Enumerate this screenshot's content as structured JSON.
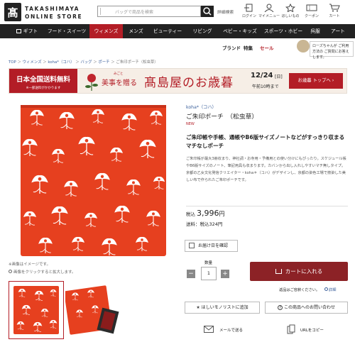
{
  "header": {
    "logo_line1": "TAKASHIMAYA",
    "logo_line2": "ONLINE STORE",
    "search_placeholder": "バッグで商品を検索",
    "advanced_search": "詳細検索",
    "icons": [
      {
        "name": "login-icon",
        "label": "ログイン"
      },
      {
        "name": "mypage-icon",
        "label": "マイメニュー"
      },
      {
        "name": "favorite-icon",
        "label": "ほしいもの"
      },
      {
        "name": "coupon-icon",
        "label": "クーポン"
      },
      {
        "name": "cart-icon",
        "label": "カート"
      }
    ]
  },
  "nav": {
    "items": [
      "ギフト",
      "フード・スイーツ",
      "ウィメンズ",
      "メンズ",
      "ビューティー",
      "リビング",
      "ベビー・キッズ",
      "スポーツ・ホビー",
      "呉服",
      "アート"
    ],
    "active_index": 2
  },
  "subnav": {
    "brand": "ブランド",
    "feature": "特集",
    "sale": "セール",
    "rose_text": "ローズちゃんが ご利用方法の ご質問にお答えします。"
  },
  "breadcrumb": [
    "TOP",
    "ウィメンズ",
    "koha*（コハ）",
    "バッグ",
    "ポーチ",
    "ご朱印ポーチ（松虫草）"
  ],
  "banner": {
    "left_line1": "日本全国送料無料",
    "left_line2": "※一部送料がかかります",
    "small": "みごと",
    "copy": "美事を贈る",
    "title": "髙島屋のお歳暮",
    "date": "12/24",
    "weekday": "[日]",
    "time": "午前10時まで",
    "cta": "お歳暮 トップへ",
    "cta_arrow": "›"
  },
  "product": {
    "brand": "koha*（コハ）",
    "name": "ご朱印ポーチ　（松虫草）",
    "badge": "NEW",
    "headline": "ご朱印帳や手帳、通帳やB6版サイズノートなどがすっきり収まるマチなしポーチ",
    "description": "ご朱印帳が最大3冊収まり、神社詞・お寺用・予備用との使い分けにもぴったり。スケジュール帳やB6版サイズのノート、筆記用具も収まります。カバンから出し入れしやすいマチ無しタイプ。京都の乙女文化発信クリエイター・koha＊（コハ）がデザインし、京都の染色工場で捺染した美しい布で作られたご朱印ポーチです。",
    "price_prefix": "税込",
    "price": "3,996",
    "price_unit": "円",
    "shipping": "送料：税込324円",
    "delivery_btn": "お届け日を確認",
    "qty_label": "数量",
    "qty": "1",
    "cart_btn": "カートに入れる",
    "returns": "返品はご容赦ください。",
    "detail_link": "詳細",
    "wish_btn": "ほしいモノリストに追加",
    "qa_btn": "この商品へのお問い合わせ",
    "mail_label": "メールで送る",
    "url_label": "URLをコピー",
    "img_note1": "※画像はイメージです。",
    "img_note2": "画像をクリックすると拡大します。"
  },
  "colors": {
    "brand_red": "#b31d26",
    "nav_bg": "#222222",
    "pouch_red": "#e6401f"
  }
}
